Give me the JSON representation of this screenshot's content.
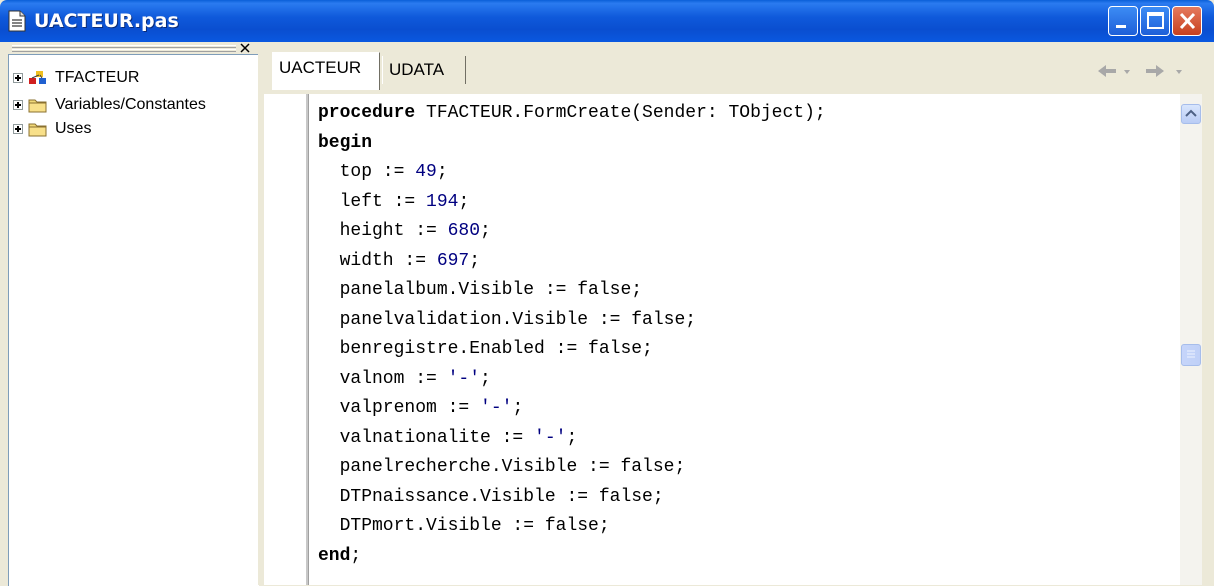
{
  "window": {
    "title": "UACTEUR.pas"
  },
  "tree": {
    "items": [
      {
        "label": "TFACTEUR",
        "icon": "class-icon"
      },
      {
        "label": "Variables/Constantes",
        "icon": "folder-icon"
      },
      {
        "label": "Uses",
        "icon": "folder-icon"
      }
    ]
  },
  "tabs": [
    {
      "label": "UACTEUR",
      "active": true
    },
    {
      "label": "UDATA",
      "active": false
    }
  ],
  "editor": {
    "lines": [
      [
        {
          "t": "procedure",
          "c": "kw"
        },
        {
          "t": " TFACTEUR.FormCreate(Sender: TObject);"
        }
      ],
      [
        {
          "t": "begin",
          "c": "kw"
        }
      ],
      [
        {
          "t": "  top := "
        },
        {
          "t": "49",
          "c": "num"
        },
        {
          "t": ";"
        }
      ],
      [
        {
          "t": "  left := "
        },
        {
          "t": "194",
          "c": "num"
        },
        {
          "t": ";"
        }
      ],
      [
        {
          "t": "  height := "
        },
        {
          "t": "680",
          "c": "num"
        },
        {
          "t": ";"
        }
      ],
      [
        {
          "t": "  width := "
        },
        {
          "t": "697",
          "c": "num"
        },
        {
          "t": ";"
        }
      ],
      [
        {
          "t": "  panelalbum.Visible := false;"
        }
      ],
      [
        {
          "t": "  panelvalidation.Visible := false;"
        }
      ],
      [
        {
          "t": "  benregistre.Enabled := false;"
        }
      ],
      [
        {
          "t": "  valnom := "
        },
        {
          "t": "'-'",
          "c": "str"
        },
        {
          "t": ";"
        }
      ],
      [
        {
          "t": "  valprenom := "
        },
        {
          "t": "'-'",
          "c": "str"
        },
        {
          "t": ";"
        }
      ],
      [
        {
          "t": "  valnationalite := "
        },
        {
          "t": "'-'",
          "c": "str"
        },
        {
          "t": ";"
        }
      ],
      [
        {
          "t": "  panelrecherche.Visible := false;"
        }
      ],
      [
        {
          "t": "  DTPnaissance.Visible := false;"
        }
      ],
      [
        {
          "t": "  DTPmort.Visible := false;"
        }
      ],
      [
        {
          "t": "end",
          "c": "kw"
        },
        {
          "t": ";"
        }
      ]
    ]
  },
  "colors": {
    "titlebar": "#0A4ED0",
    "keyword": "#000000",
    "number": "#000080",
    "string": "#000080"
  }
}
